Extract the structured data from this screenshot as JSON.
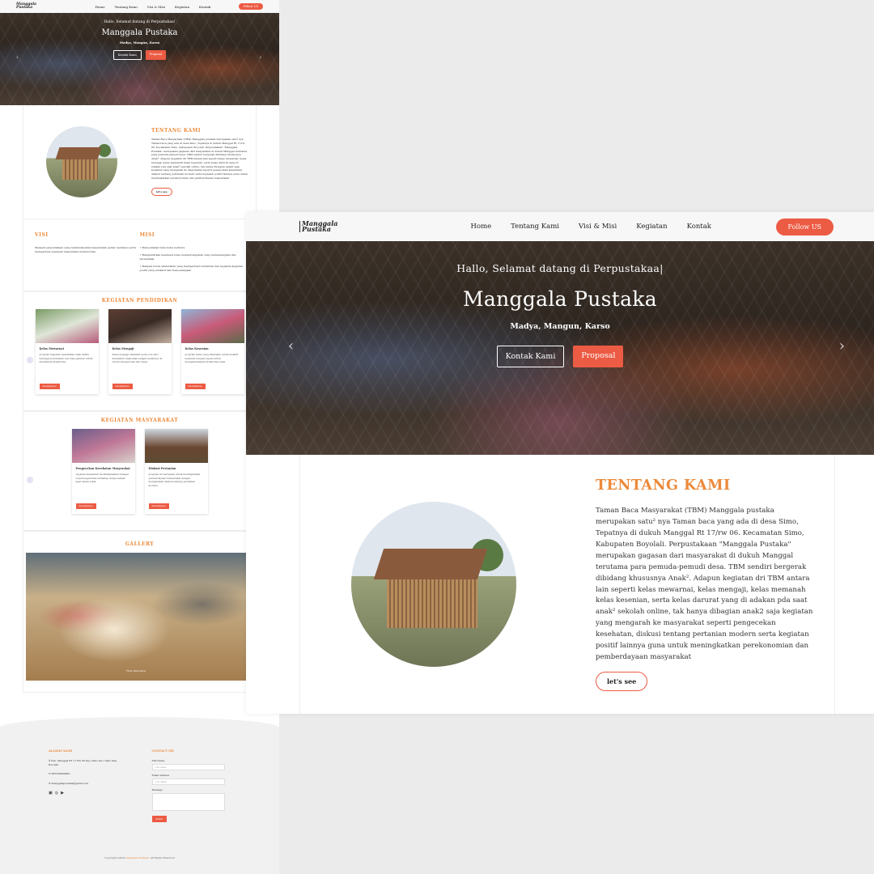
{
  "nav": {
    "logo": "Manggala Pustaka",
    "items": [
      "Home",
      "Tentang Kami",
      "Visi & Misi",
      "Kegiatan",
      "Kontak"
    ],
    "follow": "Follow US"
  },
  "hero": {
    "greeting": "Hallo, Selamat datang di Perpustakaa|",
    "greeting_small": "Hallo, Selamat datang di Perpustakaa!",
    "title": "Manggala Pustaka",
    "tagline": "Madya, Mangun, Karso",
    "btn_contact": "Kontak Kami",
    "btn_proposal": "Proposal"
  },
  "about": {
    "title": "TENTANG KAMI",
    "text": "Taman Baca Masyarakat (TBM) Manggala pustaka merupakan satu² nya Taman baca yang ada di desa Simo, Tepatnya di dukuh Manggal Rt 17/rw 06. Kecamatan Simo, Kabupaten Boyolali. Perpustakaan \"Manggala Pustaka\" merupakan gagasan dari masyarakat di dukuh Manggal terutama para pemuda-pemudi desa. TBM sendiri bergerak dibidang khususnya Anak². Adapun kegiatan dri TBM antara lain seperti kelas mewarnai, kelas mengaji, kelas memanah kelas kesenian, serta kelas darurat yang di adakan pda saat anak² sekolah online, tak hanya dibagian anak2 saja kegiatan yang mengarah ke masyarakat seperti pengecekan kesehatan, diskusi tentang pertanian modern serta kegiatan positif lainnya guna untuk meningkatkan perekonomian dan pemberdayaan masyarakat",
    "button": "let's see"
  },
  "visi": {
    "title": "VISI",
    "text": "Menjadi perpustakaan yang membudayakan masyarakat gemar membaca serta memperluas wawasan masyarakat melalui buku"
  },
  "misi": {
    "title": "MISI",
    "items": [
      "Menyediakan buku-buku bermutu",
      "Menghadirkan membaca buku menjadi kegiatan yang menyenangkan dan bermanfaat",
      "Menjadi forum silaturahmi yang memperkuat solidaritas dan kegiatan-kegiatan positif yang edukatif dan menyenangkan"
    ]
  },
  "kegiatan_pendidikan": {
    "title": "KEGIATAN PENDIDIKAN",
    "cards": [
      {
        "title": "Kelas Mewarnai",
        "text": "program kegiatan melatihkan anak dalam berbagai pembuatan seni hias gambar untuk menambah kreativitas",
        "more": "Selengkapnya"
      },
      {
        "title": "Kelas Mengaji",
        "text": "Kelas mengaji diadakan pada sore hari membantu anak-anak belajar membaca Al-Quran dengan baik dan benar",
        "more": "Selengkapnya"
      },
      {
        "title": "Kelas Kesenian",
        "text": "program kelas yang dilakukan untuk melatih kesenian dengan tujuan untuk mengembangkan kreativitas anak",
        "more": "Selengkapnya"
      }
    ]
  },
  "kegiatan_masyarakat": {
    "title": "KEGIATAN MASYARAKAT",
    "cards": [
      {
        "title": "Pengecekan Kesehatan Masyarakat",
        "text": "Layanan kesehatan ini dilaksanakan sebagai wujud kepedulian terhadap warga sekitar agar selalu sehat",
        "more": "Selengkapnya"
      },
      {
        "title": "Diskusi Pertanian",
        "text": "program ini bertujuan untuk meningkatkan pemberdayaan masyarakat dengan mengadakan diskusi tentang pertanian modern",
        "more": "Selengkapnya"
      }
    ]
  },
  "gallery": {
    "title": "GALLERY",
    "caption": "First slide label"
  },
  "footer": {
    "address_title": "ALAMAT KAMI",
    "address": "Dsn. Manggal RT 17 Rw 06 Des. Simo Kec. Simo Kab. Boyolali",
    "phone": "085328890895",
    "email": "manggalapustaka@gmail.com",
    "contact_title": "CONTACT ME",
    "name_label": "Full Name",
    "name_placeholder": "your name",
    "email_label": "Email address",
    "email_placeholder": "your email",
    "message_label": "Message",
    "send": "Kirim",
    "copyright_pre": "Copyright admin",
    "copyright_brand": "Manggala Pustaka",
    "copyright_post": ". All Rights Reserved"
  },
  "icons": [
    "map-pin-icon",
    "phone-icon",
    "envelope-icon",
    "facebook-icon",
    "instagram-icon",
    "youtube-icon",
    "chevron-left-icon",
    "chevron-right-icon"
  ],
  "colors": {
    "accent": "#ec5b43",
    "title_orange": "#ec8a3b"
  }
}
